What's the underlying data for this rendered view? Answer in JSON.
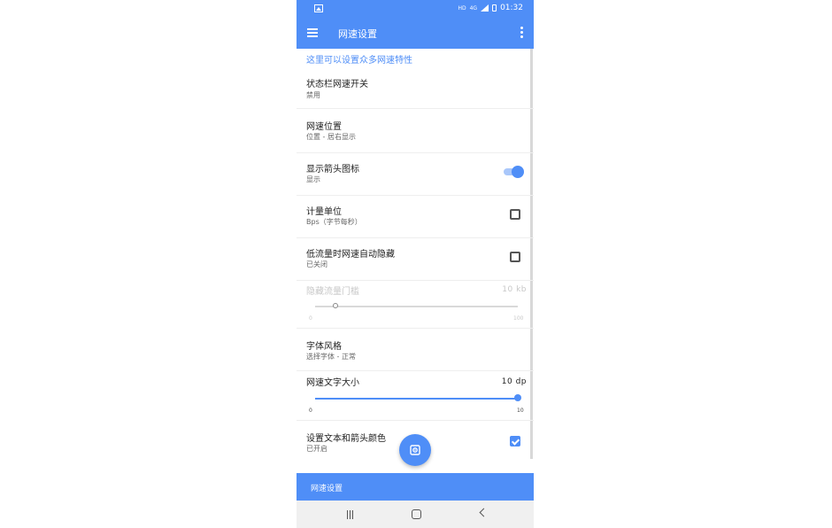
{
  "status_bar": {
    "network": "HD",
    "signal_type": "4G",
    "time": "01:32"
  },
  "app_bar": {
    "title": "网速设置"
  },
  "section_header": "这里可以设置众多网速特性",
  "prefs": [
    {
      "title": "状态栏网速开关",
      "summary": "禁用"
    },
    {
      "title": "网速位置",
      "summary": "位置 - 居右显示"
    },
    {
      "title": "显示箭头图标",
      "summary": "显示",
      "toggle_on": true
    },
    {
      "title": "计量单位",
      "summary": "Bps（字节每秒）",
      "checked": false
    },
    {
      "title": "低流量时网速自动隐藏",
      "summary": "已关闭",
      "checked": false
    },
    {
      "title": "隐藏流量门槛",
      "value": "10  kb",
      "min": "0",
      "max": "100",
      "level": 10,
      "enabled": false
    },
    {
      "title": "字体风格",
      "summary": "选择字体 - 正常"
    },
    {
      "title": "网速文字大小",
      "value": "10  dp",
      "min": "0",
      "max": "10",
      "level": 10
    },
    {
      "title": "设置文本和箭头颜色",
      "summary": "已开启",
      "checked": true
    }
  ],
  "bottom_bar": {
    "label": "网速设置"
  },
  "colors": {
    "accent": "#4f8ef7",
    "accent_light": "#a9c7fa"
  },
  "icons": [
    "image-icon",
    "menu-icon",
    "more-vert-icon",
    "gear-icon",
    "recents-icon",
    "home-icon",
    "back-icon"
  ]
}
